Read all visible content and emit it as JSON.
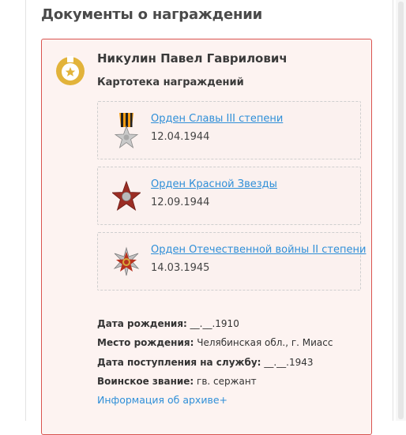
{
  "section": {
    "title": "Документы о награждении"
  },
  "person": {
    "name": "Никулин Павел Гаврилович",
    "cardfile_title": "Картотека награждений"
  },
  "awards": [
    {
      "name": "Орден Славы III степени",
      "date": "12.04.1944",
      "icon": "order-of-glory-icon"
    },
    {
      "name": "Орден Красной Звезды",
      "date": "12.09.1944",
      "icon": "order-of-red-star-icon"
    },
    {
      "name": "Орден Отечественной войны II степени",
      "date": "14.03.1945",
      "icon": "order-of-patriotic-war-icon"
    }
  ],
  "details": {
    "birth_date_label": "Дата рождения:",
    "birth_date_value": "__.__.1910",
    "birth_place_label": "Место рождения:",
    "birth_place_value": "Челябинская обл., г. Миасс",
    "service_date_label": "Дата поступления на службу:",
    "service_date_value": "__.__.1943",
    "rank_label": "Воинское звание:",
    "rank_value": "гв. сержант",
    "archive_link": "Информация об архиве+"
  },
  "colors": {
    "card_border": "#d9534f",
    "card_background": "#fdf3f1",
    "link": "#2f8fd8",
    "badge": "#e2b33a"
  }
}
